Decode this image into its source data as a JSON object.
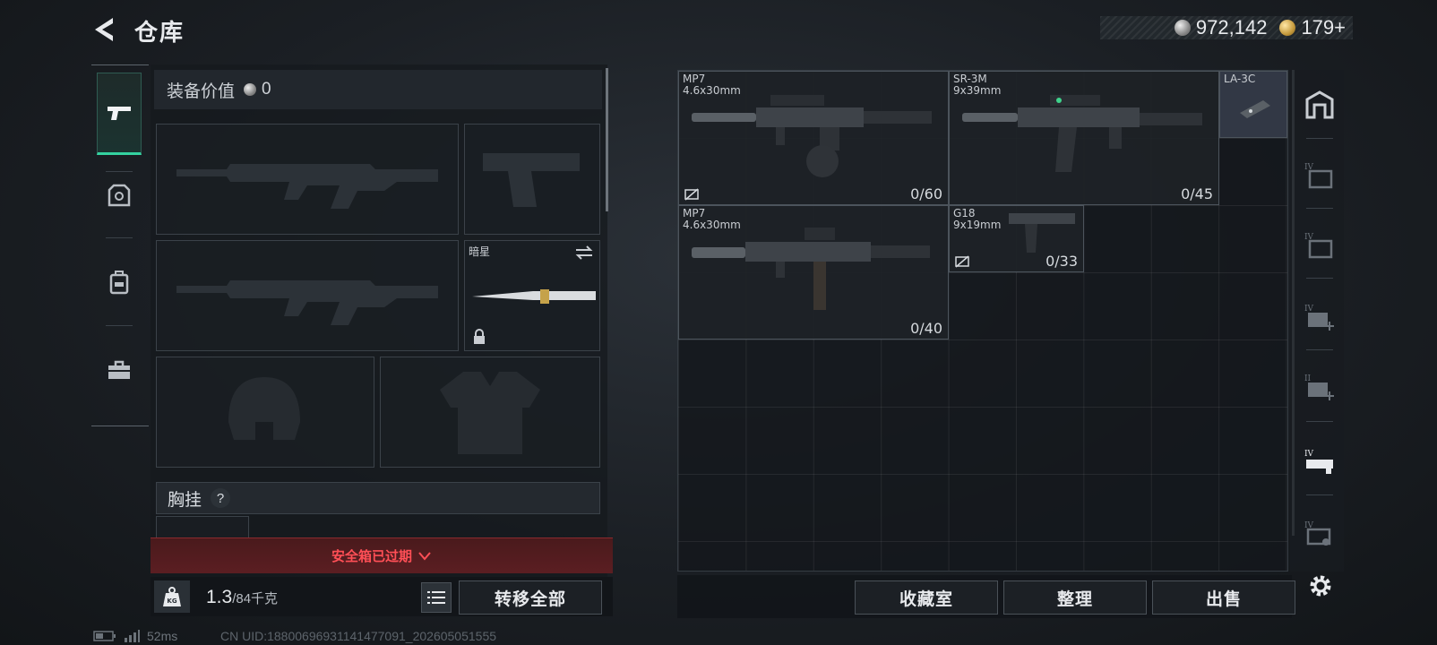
{
  "header": {
    "title": "仓库"
  },
  "currency": {
    "silver": "972,142",
    "gold": "179+"
  },
  "categories": [
    {
      "name": "weapons",
      "icon": "pistol-icon",
      "active": true
    },
    {
      "name": "helmets",
      "icon": "armor-icon",
      "active": false
    },
    {
      "name": "backpacks",
      "icon": "backpack-icon",
      "active": false
    },
    {
      "name": "toolbox",
      "icon": "toolbox-icon",
      "active": false
    }
  ],
  "loadout": {
    "equip_value_label": "装备价值",
    "equip_value": "0",
    "melee_label": "暗星",
    "chest_rig_label": "胸挂",
    "help_label": "?",
    "expired_text": "安全箱已过期",
    "weight_value": "1.3",
    "weight_capacity": "/84千克",
    "transfer_all": "转移全部"
  },
  "stash": {
    "items": [
      {
        "id": "mp7-a",
        "name": "MP7",
        "caliber": "4.6x30mm",
        "ammo": "0/60",
        "uninsured": true
      },
      {
        "id": "sr3m",
        "name": "SR-3M",
        "caliber": "9x39mm",
        "ammo": "0/45",
        "uninsured": false
      },
      {
        "id": "la3c",
        "name": "LA-3C",
        "caliber": "",
        "ammo": "",
        "uninsured": false
      },
      {
        "id": "mp7-b",
        "name": "MP7",
        "caliber": "4.6x30mm",
        "ammo": "0/40",
        "uninsured": false
      },
      {
        "id": "g18",
        "name": "G18",
        "caliber": "9x19mm",
        "ammo": "0/33",
        "uninsured": true
      }
    ],
    "buttons": {
      "collection": "收藏室",
      "sort": "整理",
      "sell": "出售"
    }
  },
  "right_rail": [
    "main-stash-icon",
    "container-icon",
    "container-icon",
    "medical-container-icon",
    "medical-container-icon",
    "weapon-container-icon",
    "key-container-icon"
  ],
  "status": {
    "ping": "52ms",
    "uid": "CN UID:18800696931141477091_202605051555"
  }
}
